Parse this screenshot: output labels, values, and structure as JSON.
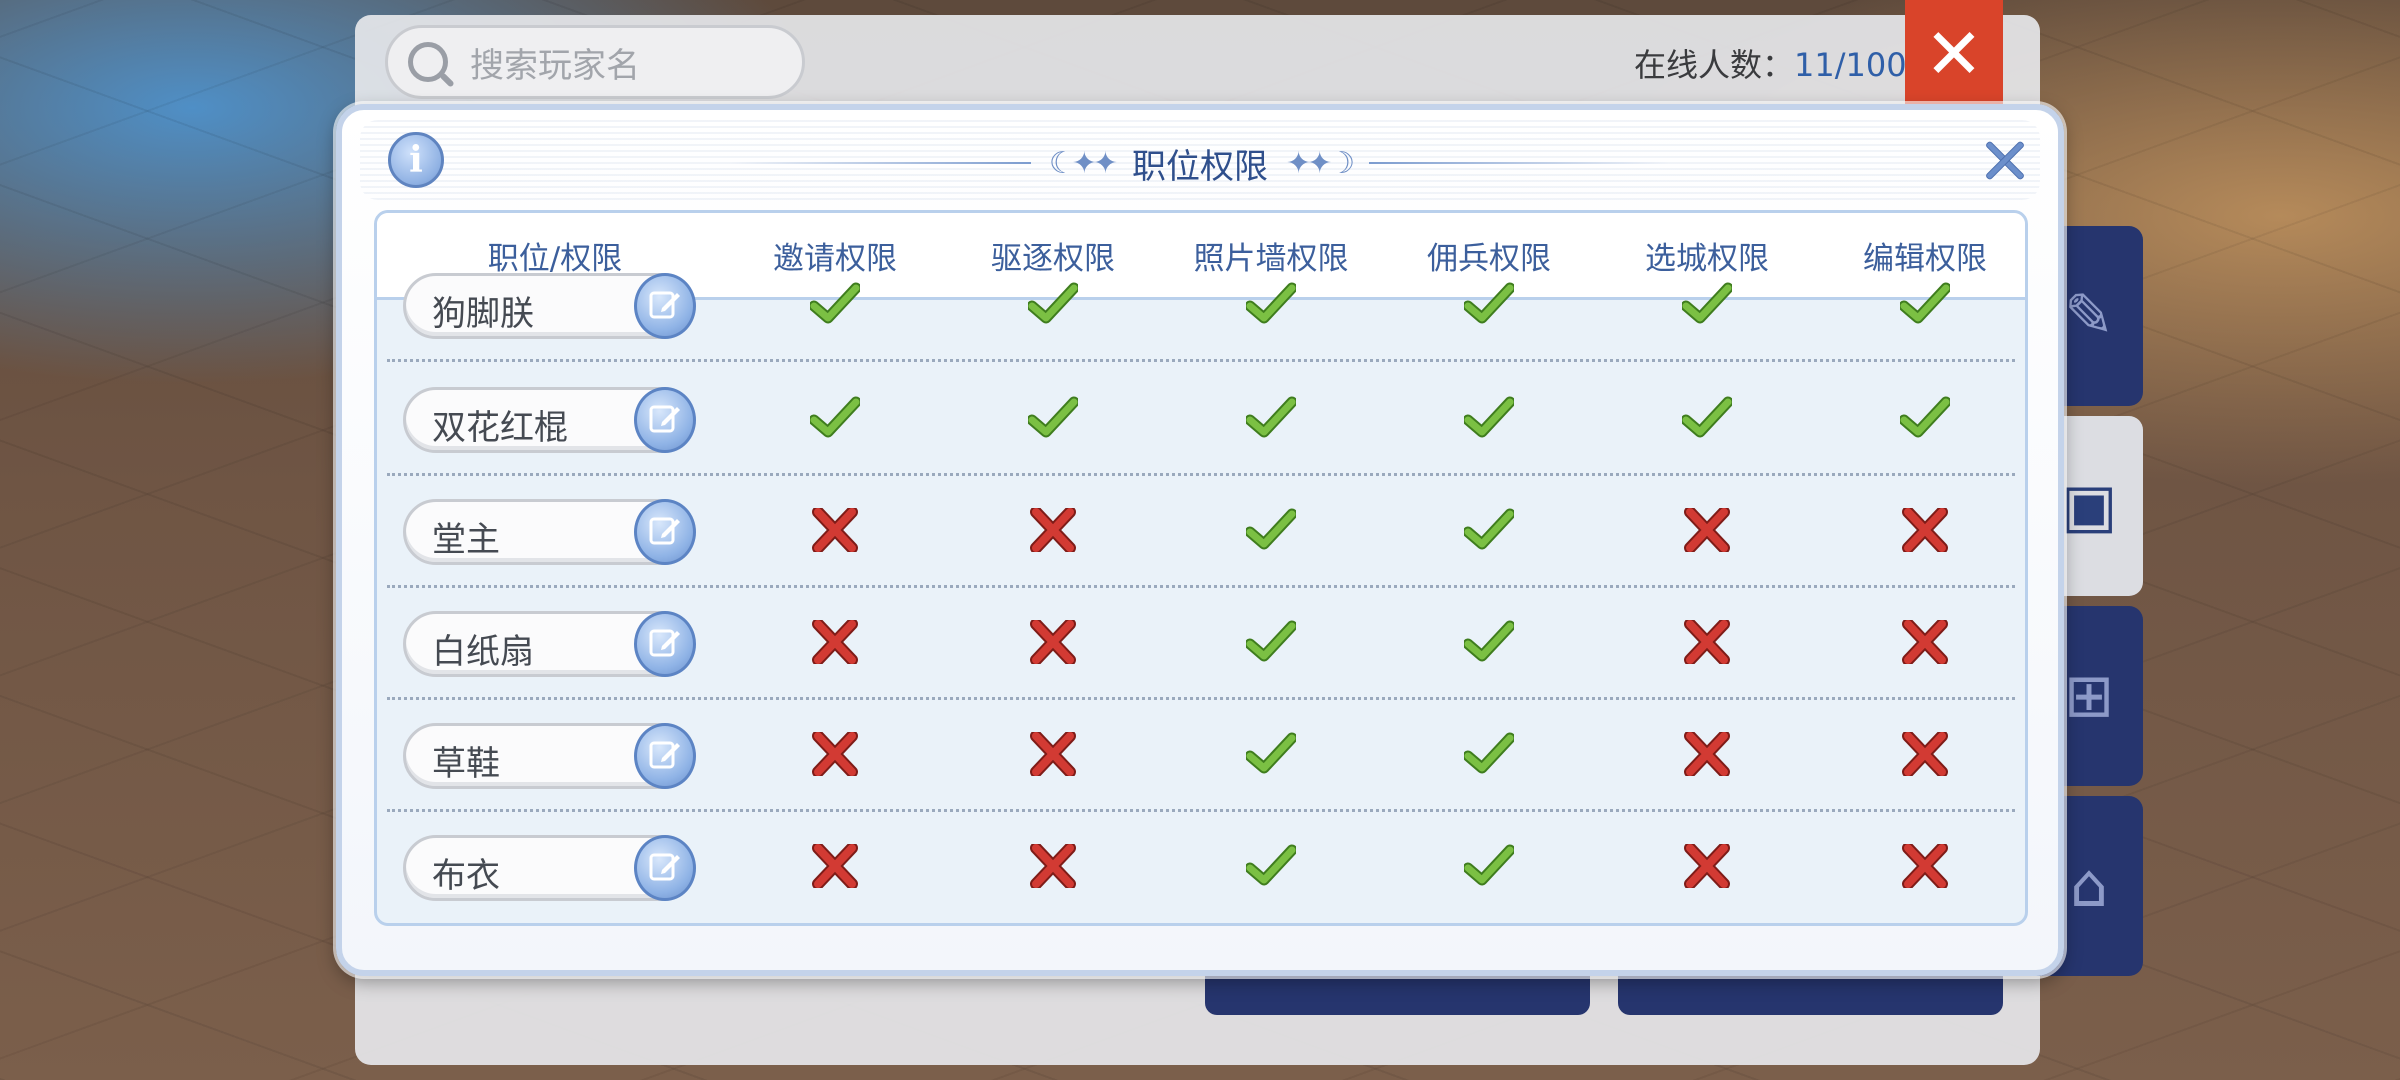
{
  "background": {
    "search": {
      "placeholder": "搜索玩家名"
    },
    "online": {
      "label": "在线人数：",
      "count": "11/100"
    },
    "close_label": "✕"
  },
  "modal": {
    "title": "职位权限",
    "info_label": "i",
    "columns": [
      "职位/权限",
      "邀请权限",
      "驱逐权限",
      "照片墙权限",
      "佣兵权限",
      "选城权限",
      "编辑权限"
    ],
    "rows": [
      {
        "role": "狗脚朕",
        "perms": [
          true,
          true,
          true,
          true,
          true,
          true
        ]
      },
      {
        "role": "双花红棍",
        "perms": [
          true,
          true,
          true,
          true,
          true,
          true
        ]
      },
      {
        "role": "堂主",
        "perms": [
          false,
          false,
          true,
          true,
          false,
          false
        ]
      },
      {
        "role": "白纸扇",
        "perms": [
          false,
          false,
          true,
          true,
          false,
          false
        ]
      },
      {
        "role": "草鞋",
        "perms": [
          false,
          false,
          true,
          true,
          false,
          false
        ]
      },
      {
        "role": "布衣",
        "perms": [
          false,
          false,
          true,
          true,
          false,
          false
        ]
      }
    ]
  },
  "colors": {
    "check": "#7bc043",
    "cross": "#d23a33",
    "title": "#2f4f8c",
    "header_text": "#3c5f9c"
  },
  "icons": {
    "check": "check-icon",
    "cross": "cross-icon",
    "edit": "edit-icon",
    "info": "info-icon",
    "close": "close-icon",
    "search": "search-icon"
  }
}
